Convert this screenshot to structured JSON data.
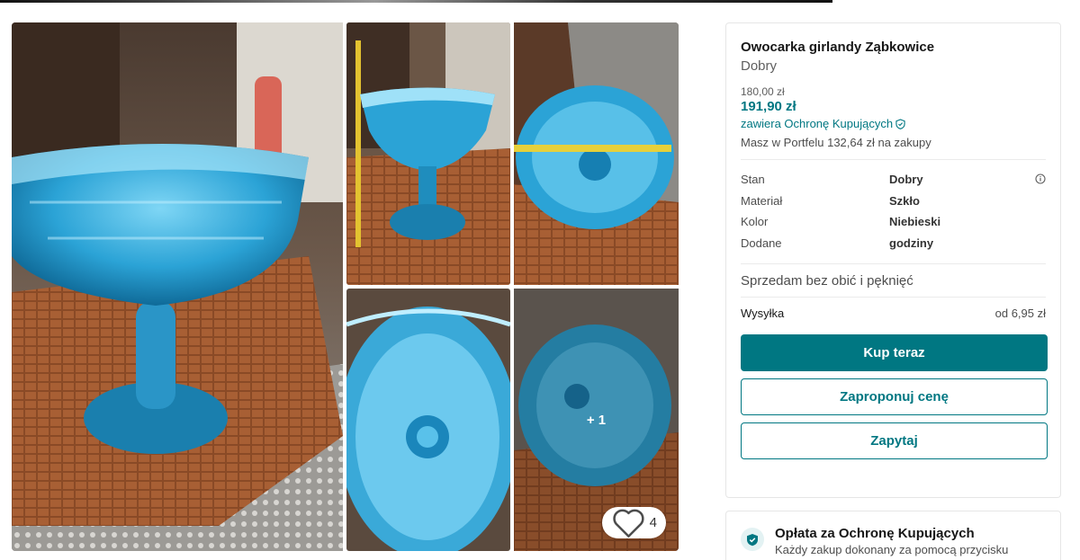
{
  "item": {
    "title": "Owocarka girlandy Ząbkowice",
    "condition_subtitle": "Dobry",
    "price": "180,00 zł",
    "price_with_protection": "191,90 zł",
    "protection_link": "zawiera Ochronę Kupujących",
    "wallet_note": "Masz w Portfelu 132,64 zł na zakupy"
  },
  "details": [
    {
      "label": "Stan",
      "value": "Dobry"
    },
    {
      "label": "Materiał",
      "value": "Szkło"
    },
    {
      "label": "Kolor",
      "value": "Niebieski"
    },
    {
      "label": "Dodane",
      "value": "godziny"
    }
  ],
  "description": "Sprzedam bez obić i pęknięć",
  "shipping": {
    "label": "Wysyłka",
    "value": "od 6,95 zł"
  },
  "buttons": {
    "buy": "Kup teraz",
    "offer": "Zaproponuj cenę",
    "ask": "Zapytaj"
  },
  "gallery": {
    "more_photos": "+ 1",
    "favourites_count": "4"
  },
  "protection_card": {
    "title": "Opłata za Ochronę Kupujących",
    "text": "Każdy zakup dokonany za pomocą przycisku"
  },
  "colors": {
    "accent": "#007782",
    "glass_blue": "#2fa8d8",
    "mat_brown": "#8a4a26"
  }
}
